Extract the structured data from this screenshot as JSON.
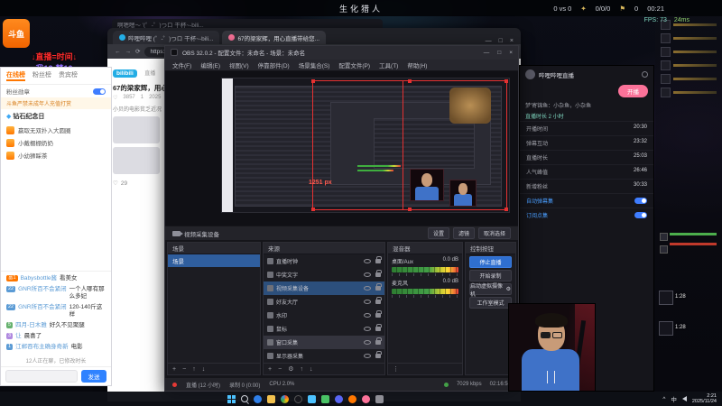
{
  "icons": {
    "star": "✦",
    "flag": "⚑",
    "heart": "♡",
    "diamond": "◆",
    "plus": "+",
    "minus": "−",
    "up": "↑",
    "down": "↓",
    "gear": "⚙",
    "dots": "⋮",
    "back": "←",
    "fwd": "→",
    "refresh": "⟳",
    "min": "—",
    "max": "□",
    "close": "×",
    "chevron_up": "^"
  },
  "hud": {
    "title": "生化猎人",
    "score": "0 vs 0",
    "kda": "0/0/0",
    "objectives": "0",
    "timer": "00:21",
    "fps": "FPS: 73",
    "ping": "24ms"
  },
  "douyu": {
    "logo": "斗鱼",
    "banner1": "↓直播=时间↓",
    "banner2": "我12-梦10"
  },
  "bg_window_title": "啊嗯嗯～ '(゜-゜)つロ 干杯~-bili...",
  "chat_window": {
    "tabs": [
      {
        "label": "在线榜"
      },
      {
        "label": "粉丝榜"
      },
      {
        "label": "贵宾榜"
      }
    ],
    "fan_badge_label": "粉丝勋章",
    "notice": "斗鱼严禁未成年人充值打赏",
    "section_title": "钻石纪念日",
    "pinned": [
      {
        "text": "赢取无双扑入大圆圈"
      },
      {
        "text": "小戴棚棚奶奶"
      },
      {
        "text": "小幼狮睬茶"
      }
    ],
    "messages": [
      {
        "badge": "富1",
        "user": "Babysbottle酱",
        "text": "看美女"
      },
      {
        "badge": "22",
        "user": "GNR所百不会紧闭",
        "text": "一个人哪有那么多妃"
      },
      {
        "badge": "22",
        "user": "GNR所百不会紧闭",
        "text": "120-140斤这样"
      },
      {
        "badge": "5",
        "user": "四月-日木雅",
        "text": "好久不见聚腿"
      },
      {
        "badge": "3",
        "user": "让",
        "text": "晨喜了"
      },
      {
        "badge": "1",
        "user": "江郸吞布主确身奇新",
        "text": "电影"
      }
    ],
    "status_line": "12人正在聊，已修改时长",
    "send_button": "发送"
  },
  "browser": {
    "tabs": [
      {
        "title": "哔哩哔哩 (゜-゜)つロ 干杯~-bili..."
      },
      {
        "title": "67的梁家辉，用心直播带给您..."
      }
    ],
    "url": "https://www...",
    "page": {
      "logo": "bilibili",
      "nav": "直播",
      "title": "67的梁家辉，用心直播带给您快乐",
      "likes": "3857",
      "views": "1",
      "date": "2025",
      "desc": "小贝的电影贫乏近况",
      "like_count": "29"
    }
  },
  "obs": {
    "title": "OBS 32.0.2 - 配置文件：未命名 - 场景：未命名",
    "menu": [
      {
        "label": "文件(F)"
      },
      {
        "label": "编辑(E)"
      },
      {
        "label": "视图(V)"
      },
      {
        "label": "停靠部件(D)"
      },
      {
        "label": "场景集合(S)"
      },
      {
        "label": "配置文件(P)"
      },
      {
        "label": "工具(T)"
      },
      {
        "label": "帮助(H)"
      }
    ],
    "preview": {
      "selection_label": "1251 px"
    },
    "source_toolbar": {
      "source_label": "视频采集设备",
      "buttons": [
        {
          "label": "设置"
        },
        {
          "label": "滤镜"
        },
        {
          "label": "取消选择"
        }
      ]
    },
    "scenes": {
      "header": "场景",
      "items": [
        {
          "name": "场景"
        }
      ]
    },
    "sources": {
      "header": "来源",
      "items": [
        {
          "name": "直播时钟"
        },
        {
          "name": "中奖文字"
        },
        {
          "name": "视频采集设备"
        },
        {
          "name": "好友大厅"
        },
        {
          "name": "水印"
        },
        {
          "name": "鼠标"
        },
        {
          "name": "窗口采集"
        },
        {
          "name": "显示器采集"
        }
      ]
    },
    "mixer": {
      "header": "混音器",
      "channels": [
        {
          "name": "桌面/Aux",
          "db": "0.0 dB"
        },
        {
          "name": "麦克风",
          "db": "0.0 dB"
        }
      ]
    },
    "controls": {
      "header": "控制按钮",
      "buttons": [
        {
          "label": "停止直播"
        },
        {
          "label": "开始录制"
        },
        {
          "label": "启动虚拟摄像机"
        },
        {
          "label": "工作室模式"
        }
      ]
    },
    "status": {
      "live": "直播 (12 小时)",
      "rec": "录制 0 (0:00)",
      "cpu": "CPU 2.0%",
      "bitrate": "7029 kbps",
      "time": "02:16:59"
    }
  },
  "dashboard": {
    "app_title": "哔哩哔哩直播",
    "live_button": "开播",
    "top_message": "梦'寄锦鱼：小杂鱼，小杂鱼",
    "duration": "直播时长 2 小时",
    "rows": [
      {
        "label": "开播时间",
        "value": "20:30"
      },
      {
        "label": "弹幕互动",
        "value": "23:32"
      },
      {
        "label": "直播时长",
        "value": "25:03"
      },
      {
        "label": "人气峰值",
        "value": "26:46"
      },
      {
        "label": "新增粉丝",
        "value": "30:33"
      }
    ],
    "toggles": [
      {
        "label": "自动弹幕集"
      },
      {
        "label": "订阅点集"
      }
    ]
  },
  "game_panel": {
    "cooldown1": "1:28",
    "cooldown2": "1:28"
  },
  "taskbar": {
    "time": "2:21",
    "date": "2025/11/24",
    "lang": "中"
  }
}
